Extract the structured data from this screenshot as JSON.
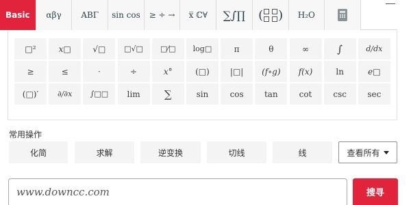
{
  "tabs": [
    {
      "label": "Basic",
      "icon": "basic-tab"
    },
    {
      "label": "αβγ",
      "icon": "greek-lowercase-tab"
    },
    {
      "label": "ΑΒΓ",
      "icon": "greek-uppercase-tab"
    },
    {
      "label": "sin cos",
      "icon": "trig-tab"
    },
    {
      "label": "≥ ÷ →",
      "icon": "operators-tab"
    },
    {
      "label": "x̅ ℂ∀",
      "icon": "notation-tab"
    },
    {
      "label": "∑∫∏",
      "icon": "calculus-tab"
    },
    {
      "label": "matrix",
      "icon": "matrix-icon"
    },
    {
      "label": "H₂O",
      "icon": "chemistry-tab"
    },
    {
      "label": "calculator",
      "icon": "calculator-icon"
    }
  ],
  "accent_color": "#e1243c",
  "keys": [
    {
      "label": "□²",
      "name": "square-key"
    },
    {
      "label": "x□",
      "name": "power-key"
    },
    {
      "label": "√□",
      "name": "sqrt-key"
    },
    {
      "label": "□√□",
      "name": "nth-root-key"
    },
    {
      "label": "□⁄□",
      "name": "fraction-key"
    },
    {
      "label": "log□",
      "name": "log-base-key"
    },
    {
      "label": "π",
      "name": "pi-key"
    },
    {
      "label": "θ",
      "name": "theta-key"
    },
    {
      "label": "∞",
      "name": "infinity-key"
    },
    {
      "label": "∫",
      "name": "integral-key"
    },
    {
      "label": "d/dx",
      "name": "derivative-key"
    },
    {
      "label": "≥",
      "name": "greater-equal-key"
    },
    {
      "label": "≤",
      "name": "less-equal-key"
    },
    {
      "label": "·",
      "name": "dot-key"
    },
    {
      "label": "÷",
      "name": "divide-key"
    },
    {
      "label": "x°",
      "name": "degree-key"
    },
    {
      "label": "(□)",
      "name": "parentheses-key"
    },
    {
      "label": "|□|",
      "name": "absolute-key"
    },
    {
      "label": "(f∘g)",
      "name": "composition-key"
    },
    {
      "label": "f(x)",
      "name": "function-key"
    },
    {
      "label": "ln",
      "name": "ln-key"
    },
    {
      "label": "e□",
      "name": "exp-key"
    },
    {
      "label": "(□)′",
      "name": "prime-key"
    },
    {
      "label": "∂/∂x",
      "name": "partial-key"
    },
    {
      "label": "∫□□",
      "name": "definite-integral-key"
    },
    {
      "label": "lim",
      "name": "lim-key"
    },
    {
      "label": "∑",
      "name": "sum-key"
    },
    {
      "label": "sin",
      "name": "sin-key"
    },
    {
      "label": "cos",
      "name": "cos-key"
    },
    {
      "label": "tan",
      "name": "tan-key"
    },
    {
      "label": "cot",
      "name": "cot-key"
    },
    {
      "label": "csc",
      "name": "csc-key"
    },
    {
      "label": "sec",
      "name": "sec-key"
    }
  ],
  "common_ops": {
    "title": "常用操作",
    "buttons": [
      "化简",
      "求解",
      "逆变换",
      "切线",
      "线"
    ],
    "see_all": "查看所有"
  },
  "search": {
    "value": "www.downcc.com",
    "button_label": "搜寻"
  }
}
